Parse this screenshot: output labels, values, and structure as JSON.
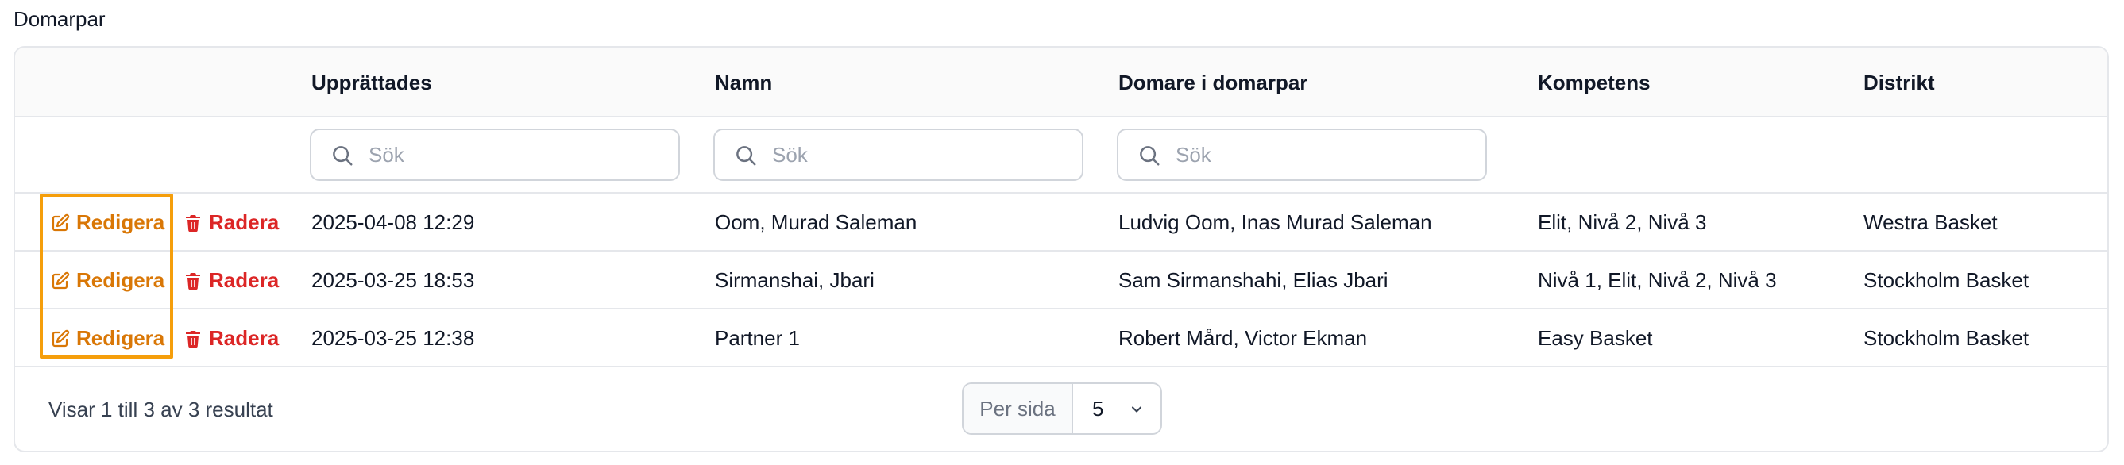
{
  "section": {
    "title": "Domarpar"
  },
  "table": {
    "columns": {
      "established": "Upprättades",
      "name": "Namn",
      "referees": "Domare i domarpar",
      "competence": "Kompetens",
      "district": "Distrikt"
    },
    "search_placeholder": "Sök",
    "actions": {
      "edit_label": "Redigera",
      "delete_label": "Radera"
    },
    "rows": [
      {
        "established": "2025-04-08 12:29",
        "name": "Oom, Murad Saleman",
        "referees": "Ludvig Oom, Inas Murad Saleman",
        "competence": "Elit, Nivå 2, Nivå 3",
        "district": "Westra Basket"
      },
      {
        "established": "2025-03-25 18:53",
        "name": "Sirmanshai, Jbari",
        "referees": "Sam Sirmanshahi, Elias Jbari",
        "competence": "Nivå 1, Elit, Nivå 2, Nivå 3",
        "district": "Stockholm Basket"
      },
      {
        "established": "2025-03-25 12:38",
        "name": "Partner 1",
        "referees": "Robert Mård, Victor Ekman",
        "competence": "Easy Basket",
        "district": "Stockholm Basket"
      }
    ]
  },
  "footer": {
    "result_text": "Visar 1 till 3 av 3 resultat",
    "per_page_label": "Per sida",
    "per_page_value": "5"
  },
  "colors": {
    "edit": "#d97706",
    "delete": "#dc2626",
    "highlight": "#f59e0b"
  },
  "icons": {
    "edit": "edit-icon",
    "delete": "trash-icon",
    "search": "search-icon",
    "chevron": "chevron-down-icon"
  }
}
